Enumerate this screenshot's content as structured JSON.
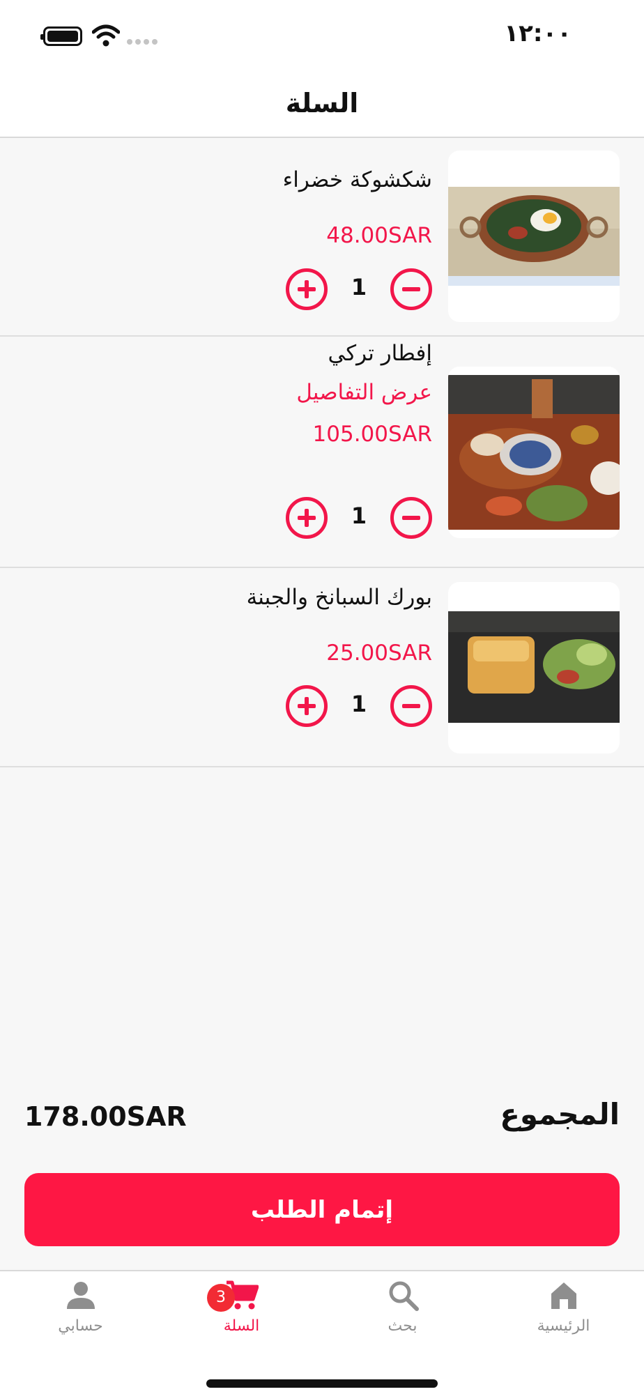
{
  "status_bar": {
    "time": "١٢:٠٠"
  },
  "header": {
    "title": "السلة"
  },
  "cart": {
    "items": [
      {
        "name": "شكشوكة خضراء",
        "link": "",
        "price": "48.00SAR",
        "quantity": "1",
        "image": "shakshuka-photo"
      },
      {
        "name": "إفطار تركي",
        "link": "عرض التفاصيل",
        "price": "105.00SAR",
        "quantity": "1",
        "image": "turkish-breakfast-photo"
      },
      {
        "name": "بورك السبانخ والجبنة",
        "link": "",
        "price": "25.00SAR",
        "quantity": "1",
        "image": "borek-photo"
      }
    ]
  },
  "summary": {
    "total_label": "المجموع",
    "total_value": "178.00SAR"
  },
  "checkout": {
    "label": "إتمام الطلب"
  },
  "tab_bar": {
    "tabs": [
      {
        "label": "حسابي",
        "icon": "person-icon"
      },
      {
        "label": "السلة",
        "icon": "cart-icon",
        "badge": "3"
      },
      {
        "label": "بحث",
        "icon": "search-icon"
      },
      {
        "label": "الرئيسية",
        "icon": "home-icon"
      }
    ]
  },
  "colors": {
    "accent": "#f2164a",
    "button": "#fe1744",
    "badge": "#f22b34",
    "inactive": "#8e8e8e"
  }
}
